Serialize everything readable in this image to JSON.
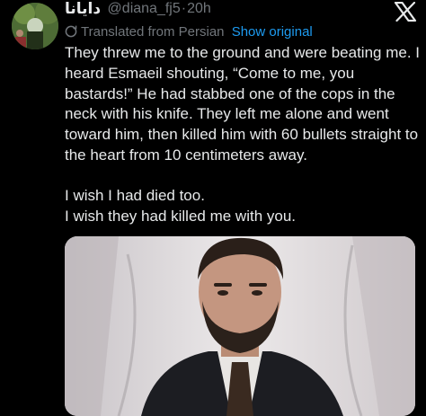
{
  "post": {
    "display_name": "دایانا",
    "handle": "@diana_fj5",
    "separator": "·",
    "time": "20h",
    "translated_label": "Translated from Persian",
    "show_original_label": "Show original",
    "paragraphs": [
      "They threw me to the ground and were beating me. I heard Esmaeil shouting, “Come to me, you bastards!” He had stabbed one of the cops in the neck with his knife. They left me alone and went toward him, then killed him with 60 bullets straight to the heart from 10 centimeters away.",
      "I wish I had died too.\nI wish they had killed me with you."
    ]
  },
  "icons": {
    "platform": "x-logo-icon",
    "translate": "globe-icon"
  },
  "colors": {
    "background": "#000000",
    "text": "#e7e9ea",
    "muted": "#71767b",
    "link": "#1d9bf0"
  }
}
